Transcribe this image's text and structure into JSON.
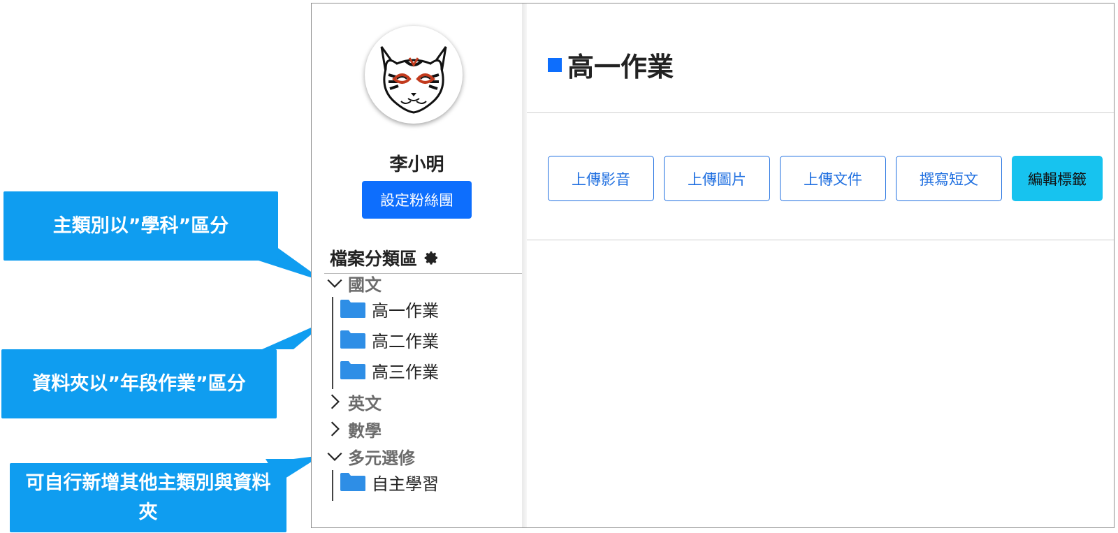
{
  "user": {
    "name": "李小明",
    "fan_button": "設定粉絲團"
  },
  "sidebar": {
    "section_title": "檔案分類區",
    "categories": [
      {
        "label": "國文",
        "expanded": true,
        "folders": [
          "高一作業",
          "高二作業",
          "高三作業"
        ]
      },
      {
        "label": "英文",
        "expanded": false
      },
      {
        "label": "數學",
        "expanded": false
      },
      {
        "label": "多元選修",
        "expanded": true,
        "folders": [
          "自主學習"
        ]
      }
    ]
  },
  "main": {
    "title": "高一作業",
    "toolbar": {
      "upload_video": "上傳影音",
      "upload_image": "上傳圖片",
      "upload_doc": "上傳文件",
      "write_article": "撰寫短文",
      "edit_tags": "編輯標籤"
    }
  },
  "callouts": {
    "category_note": "主類別以”學科”區分",
    "folder_note": "資料夾以”年段作業”區分",
    "custom_note": "可自行新增其他主類別與資料夾"
  },
  "colors": {
    "primary": "#0d6efd",
    "accent": "#17c3ef",
    "callout": "#0f9df0",
    "folder": "#2e8ee6"
  },
  "icons": [
    "gear-icon",
    "chevron-down-icon",
    "chevron-right-icon",
    "folder-icon"
  ]
}
